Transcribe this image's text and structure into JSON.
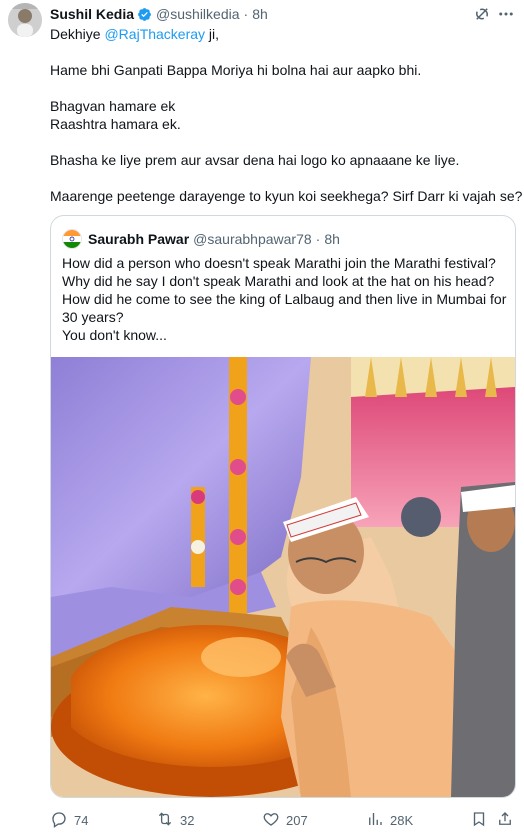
{
  "author": {
    "name": "Sushil Kedia",
    "handle": "@sushilkedia",
    "time": "8h",
    "verified_color": "#1d9bf0"
  },
  "tweet": {
    "line1_prefix": "Dekhiye ",
    "line1_mention": "@RajThackeray",
    "line1_suffix": " ji,",
    "line2": "Hame bhi Ganpati Bappa Moriya hi bolna hai aur aapko bhi.",
    "line3": "Bhagvan hamare ek",
    "line4": "Raashtra hamara ek.",
    "line5": "Bhasha ke liye prem aur avsar dena hai logo ko apnaaane ke liye.",
    "line6": "Maarenge peetenge darayenge to kyun koi seekhega? Sirf Darr ki vajah se?"
  },
  "quote": {
    "name": "Saurabh Pawar",
    "handle": "@saurabhpawar78",
    "time": "8h",
    "lines": [
      "How did a person who doesn't speak Marathi join the Marathi festival?",
      "Why did he say I don't speak Marathi and look at the hat on his head?",
      "How did he come to see the king of Lalbaug and then live in Mumbai for",
      "30 years?",
      "You don't know..."
    ]
  },
  "actions": {
    "replies": "74",
    "reposts": "32",
    "likes": "207",
    "views": "28K"
  },
  "icons": {
    "grok": "grok-icon",
    "more": "more-icon",
    "reply": "reply-icon",
    "repost": "repost-icon",
    "like": "like-icon",
    "views": "views-icon",
    "bookmark": "bookmark-icon"
  }
}
